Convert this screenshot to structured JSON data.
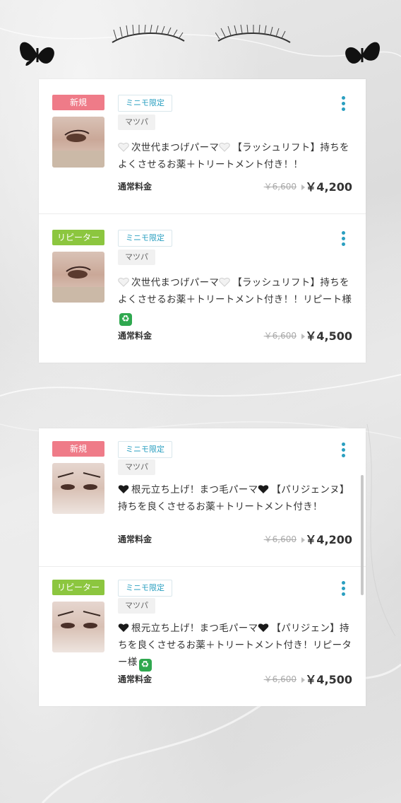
{
  "colors": {
    "new_badge": "#ef7b88",
    "repeater_badge": "#8cc63f",
    "accent": "#2a9fc0"
  },
  "decor": {
    "left": "butterfly-icon",
    "center": "eyelash-icon",
    "right": "butterfly-icon"
  },
  "cards": [
    {
      "items": [
        {
          "badge": "新規",
          "badge_type": "new",
          "limited": "ミニモ限定",
          "category": "マツパ",
          "heart": "white",
          "title": "次世代まつげパーマ",
          "title_rest": "【ラッシュリフト】持ちをよくさせるお薬＋トリートメント付き！！",
          "suffix": "",
          "recycle": false,
          "price_label": "通常料金",
          "old_price": "￥6,600",
          "price": "￥4,200"
        },
        {
          "badge": "リピーター",
          "badge_type": "rep",
          "limited": "ミニモ限定",
          "category": "マツパ",
          "heart": "white",
          "title": "次世代まつげパーマ",
          "title_rest": "【ラッシュリフト】持ちをよくさせるお薬＋トリートメント付き！！リピート様",
          "suffix": "",
          "recycle": true,
          "price_label": "通常料金",
          "old_price": "￥6,600",
          "price": "￥4,500"
        }
      ]
    },
    {
      "items": [
        {
          "badge": "新規",
          "badge_type": "new",
          "limited": "ミニモ限定",
          "category": "マツパ",
          "heart": "black",
          "title": "根元立ち上げ！まつ毛パーマ",
          "title_rest": "【パリジェンヌ】持ちを良くさせるお薬＋トリートメント付き！",
          "suffix": "",
          "recycle": false,
          "price_label": "通常料金",
          "old_price": "￥6,600",
          "price": "￥4,200"
        },
        {
          "badge": "リピーター",
          "badge_type": "rep",
          "limited": "ミニモ限定",
          "category": "マツパ",
          "heart": "black",
          "title": "根元立ち上げ！まつ毛パーマ",
          "title_rest": "【パリジェン】持ちを良くさせるお薬＋トリートメント付き！リピーター様",
          "suffix": "",
          "recycle": true,
          "price_label": "通常料金",
          "old_price": "￥6,600",
          "price": "￥4,500"
        }
      ]
    }
  ]
}
